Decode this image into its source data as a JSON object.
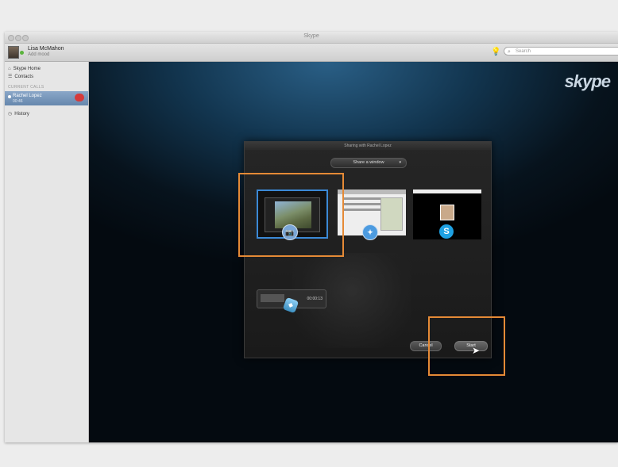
{
  "window": {
    "title": "Skype"
  },
  "profile": {
    "name": "Lisa McMahon",
    "mood": "Add mood"
  },
  "search": {
    "placeholder": "Search",
    "icon": "search-icon"
  },
  "sidebar": {
    "items": [
      {
        "label": "Skype Home",
        "icon": "home-icon"
      },
      {
        "label": "Contacts",
        "icon": "contacts-icon"
      }
    ],
    "section_header": "CURRENT CALLS",
    "active_call": {
      "name": "Rachel Lopez",
      "status": "00:46"
    },
    "history_label": "History"
  },
  "logo_text": "skype",
  "dialog": {
    "title": "Sharing with Rachel Lopez",
    "dropdown_value": "Share a window",
    "mini_window_text": "00:00:13",
    "cancel_label": "Cancel",
    "start_label": "Start"
  },
  "colors": {
    "highlight": "#e58a36",
    "selection": "#3b89d6",
    "end_call": "#d63a3a"
  }
}
